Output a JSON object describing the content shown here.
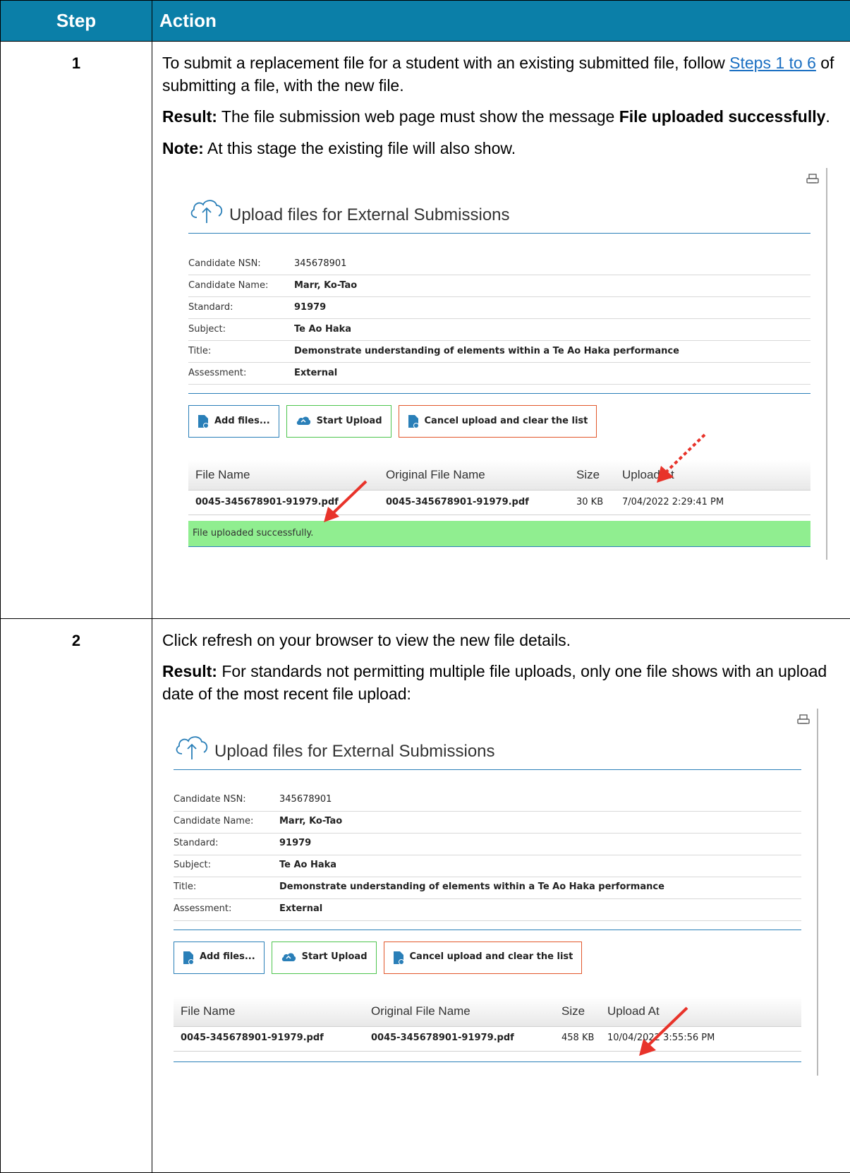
{
  "table": {
    "headers": {
      "step": "Step",
      "action": "Action"
    },
    "rows": [
      {
        "step": "1",
        "p1_before": "To submit a replacement file for a student with an existing submitted file, follow ",
        "p1_link": "Steps 1 to 6",
        "p1_after": " of submitting a file, with the new file.",
        "result_label": "Result:",
        "result_text": " The file submission web page must show the message ",
        "result_bold": "File uploaded successfully",
        "result_end": ".",
        "note_label": "Note:",
        "note_text": " At this stage the existing file will also show."
      },
      {
        "step": "2",
        "p1": "Click refresh on your browser to view the new file details.",
        "result_label": "Result:",
        "result_text": " For standards not permitting multiple file uploads, only one file shows with an  upload date of the most recent file upload:"
      }
    ]
  },
  "shot1": {
    "title": "Upload files for External Submissions",
    "fields": [
      {
        "label": "Candidate NSN:",
        "value": "345678901"
      },
      {
        "label": "Candidate Name:",
        "value": "Marr, Ko-Tao"
      },
      {
        "label": "Standard:",
        "value": "91979"
      },
      {
        "label": "Subject:",
        "value": "Te Ao Haka"
      },
      {
        "label": "Title:",
        "value": "Demonstrate understanding of elements within a Te Ao Haka performance"
      },
      {
        "label": "Assessment:",
        "value": "External"
      }
    ],
    "buttons": {
      "add": "Add files...",
      "start": "Start Upload",
      "cancel": "Cancel upload and clear the list"
    },
    "columns": {
      "file_name": "File Name",
      "original": "Original File Name",
      "size": "Size",
      "upload_at": "Upload At"
    },
    "file": {
      "file_name": "0045-345678901-91979.pdf",
      "original": "0045-345678901-91979.pdf",
      "size": "30 KB",
      "upload_at": "7/04/2022 2:29:41 PM"
    },
    "success": "File uploaded successfully."
  },
  "shot2": {
    "title": "Upload files for External Submissions",
    "fields": [
      {
        "label": "Candidate NSN:",
        "value": "345678901"
      },
      {
        "label": "Candidate Name:",
        "value": "Marr, Ko-Tao"
      },
      {
        "label": "Standard:",
        "value": "91979"
      },
      {
        "label": "Subject:",
        "value": "Te Ao Haka"
      },
      {
        "label": "Title:",
        "value": "Demonstrate understanding of elements within a Te Ao Haka performance"
      },
      {
        "label": "Assessment:",
        "value": "External"
      }
    ],
    "buttons": {
      "add": "Add files...",
      "start": "Start Upload",
      "cancel": "Cancel upload and clear the list"
    },
    "columns": {
      "file_name": "File Name",
      "original": "Original File Name",
      "size": "Size",
      "upload_at": "Upload At"
    },
    "file": {
      "file_name": "0045-345678901-91979.pdf",
      "original": "0045-345678901-91979.pdf",
      "size": "458 KB",
      "upload_at": "10/04/2022 3:55:56 PM"
    }
  },
  "colors": {
    "header_bg": "#0b7fa8",
    "accent_line": "#2a7fb8",
    "success_bg": "#90ee90",
    "arrow": "#e8332a"
  }
}
